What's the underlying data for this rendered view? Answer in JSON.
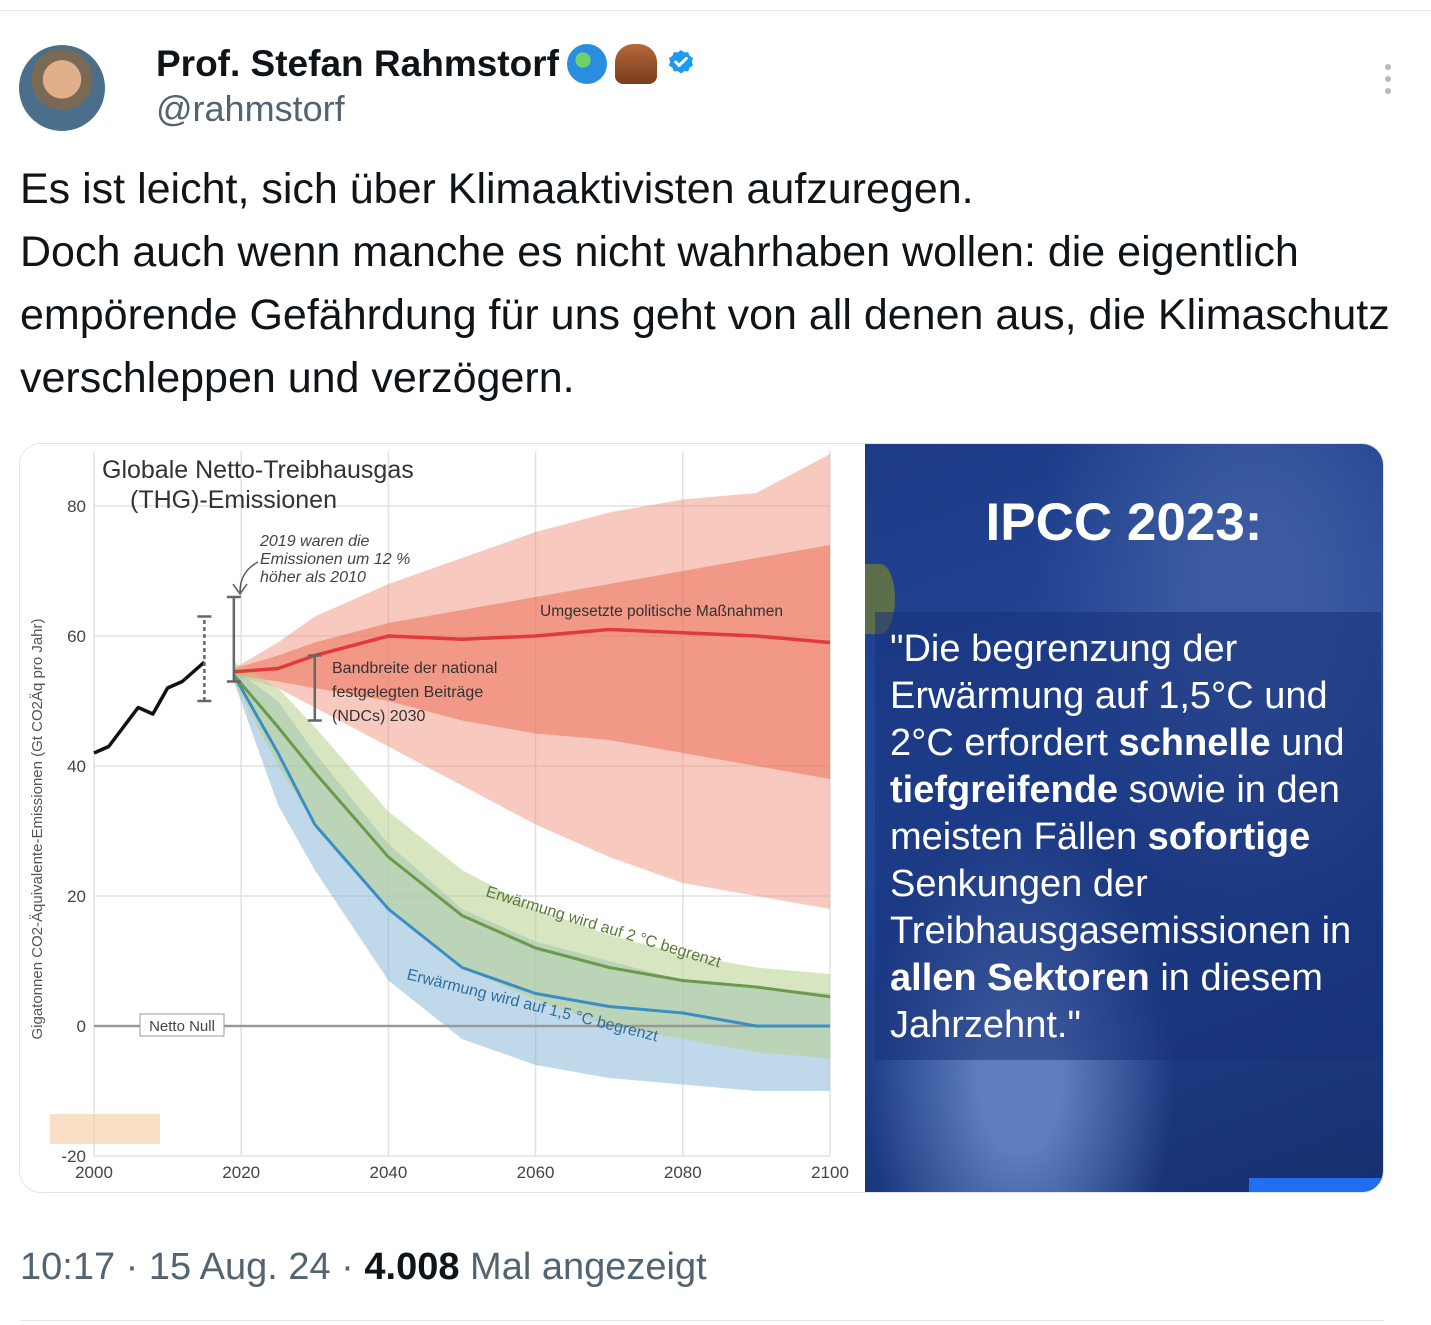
{
  "tweet": {
    "display_name": "Prof. Stefan Rahmstorf",
    "name_emojis": [
      "globe-icon",
      "mammoth-icon"
    ],
    "handle": "@rahmstorf",
    "text": "Es ist leicht, sich über Klimaaktivisten aufzuregen.\nDoch auch wenn manche es nicht wahrhaben wollen: die eigentlich empörende Gefährdung für uns geht von all denen aus, die Klimaschutz verschleppen und verzögern.",
    "time": "10:17",
    "date": "15 Aug. 24",
    "views_count": "4.008",
    "views_label": "Mal angezeigt",
    "separator": " · "
  },
  "ipcc_panel": {
    "title": "IPCC 2023:",
    "quote_parts": [
      {
        "text": "\"Die begrenzung der Erwärmung auf 1,5°C und 2°C erfordert ",
        "bold": false
      },
      {
        "text": "schnelle",
        "bold": true
      },
      {
        "text": " und ",
        "bold": false
      },
      {
        "text": "tiefgreifende",
        "bold": true
      },
      {
        "text": " sowie in den meisten Fällen ",
        "bold": false
      },
      {
        "text": "sofortige",
        "bold": true
      },
      {
        "text": " Senkungen der Treibhausgasemissionen in ",
        "bold": false
      },
      {
        "text": "allen Sektoren",
        "bold": true
      },
      {
        "text": " in diesem Jahrzehnt.\"",
        "bold": false
      }
    ]
  },
  "chart_data": {
    "type": "area",
    "title": "Globale Netto-Treibhausgas (THG)-Emissionen",
    "title_lines": [
      "Globale Netto-Treibhausgas",
      "(THG)-Emissionen"
    ],
    "ylabel": "Gigatonnen CO2-Äquivalente-Emissionen (Gt CO2Äq pro Jahr)",
    "xlabel": "",
    "xlim": [
      2000,
      2100
    ],
    "ylim": [
      -20,
      80
    ],
    "x_ticks": [
      "2000",
      "2020",
      "2040",
      "2060",
      "2080",
      "2100"
    ],
    "y_ticks": [
      "-20",
      "0",
      "20",
      "40",
      "60",
      "80"
    ],
    "grid": true,
    "series": [
      {
        "name": "historisch",
        "color": "#111111",
        "x": [
          2000,
          2002,
          2004,
          2006,
          2008,
          2010,
          2012,
          2014,
          2015
        ],
        "y": [
          42,
          43,
          46,
          49,
          48,
          52,
          53,
          55,
          56
        ]
      },
      {
        "name": "Umgesetzte politische Maßnahmen",
        "color": "#e03a3a",
        "x": [
          2019,
          2025,
          2030,
          2040,
          2050,
          2060,
          2070,
          2080,
          2090,
          2100
        ],
        "y": [
          54.5,
          55,
          57,
          60,
          59.5,
          60,
          61,
          60.5,
          60,
          59
        ],
        "band_inner_low": [
          54,
          53,
          52,
          50,
          47,
          45,
          44,
          42,
          40,
          38
        ],
        "band_inner_high": [
          55,
          57,
          59,
          62,
          64,
          66,
          68,
          70,
          72,
          74
        ],
        "band_outer_low": [
          54,
          52,
          49,
          43,
          37,
          31,
          26,
          22,
          20,
          18
        ],
        "band_outer_high": [
          55,
          59,
          63,
          68,
          72,
          76,
          79,
          81,
          82,
          88
        ]
      },
      {
        "name": "Erwärmung wird auf 2 °C begrenzt",
        "color": "#6a9a4a",
        "x": [
          2019,
          2025,
          2030,
          2040,
          2050,
          2060,
          2070,
          2080,
          2090,
          2100
        ],
        "y": [
          54,
          46,
          39,
          26,
          17,
          12,
          9,
          7,
          6,
          4.5
        ],
        "band_low": [
          53,
          40,
          31,
          18,
          9,
          4,
          0,
          -2,
          -4,
          -5
        ],
        "band_high": [
          56,
          52,
          46,
          33,
          24,
          18,
          14,
          11,
          9,
          8
        ]
      },
      {
        "name": "Erwärmung wird auf 1,5 °C begrenzt",
        "color": "#3a8ec2",
        "x": [
          2019,
          2025,
          2030,
          2040,
          2050,
          2060,
          2070,
          2080,
          2090,
          2100
        ],
        "y": [
          54,
          42,
          31,
          18,
          9,
          5,
          3,
          2,
          0,
          0
        ],
        "band_low": [
          53,
          34,
          24,
          7,
          -2,
          -6,
          -8,
          -9,
          -10,
          -10
        ],
        "band_high": [
          55,
          50,
          42,
          28,
          18,
          13,
          10,
          7,
          6,
          5
        ]
      }
    ],
    "error_bars": [
      {
        "x": 2015,
        "low": 50,
        "high": 63
      },
      {
        "x": 2019,
        "low": 53,
        "high": 66
      },
      {
        "x": 2030,
        "low": 47,
        "high": 57
      }
    ],
    "annotations": {
      "emissions_2019": [
        "2019 waren die",
        "Emissionen um 12 %",
        "höher als 2010"
      ],
      "ndc_range": [
        "Bandbreite der national",
        "festgelegten Beiträge",
        "(NDCs) 2030"
      ],
      "net_zero": "Netto Null",
      "policies_label": "Umgesetzte politische Maßnahmen",
      "label_2c": "Erwärmung wird auf 2 °C begrenzt",
      "label_15c": "Erwärmung wird auf 1,5 °C begrenzt"
    }
  }
}
